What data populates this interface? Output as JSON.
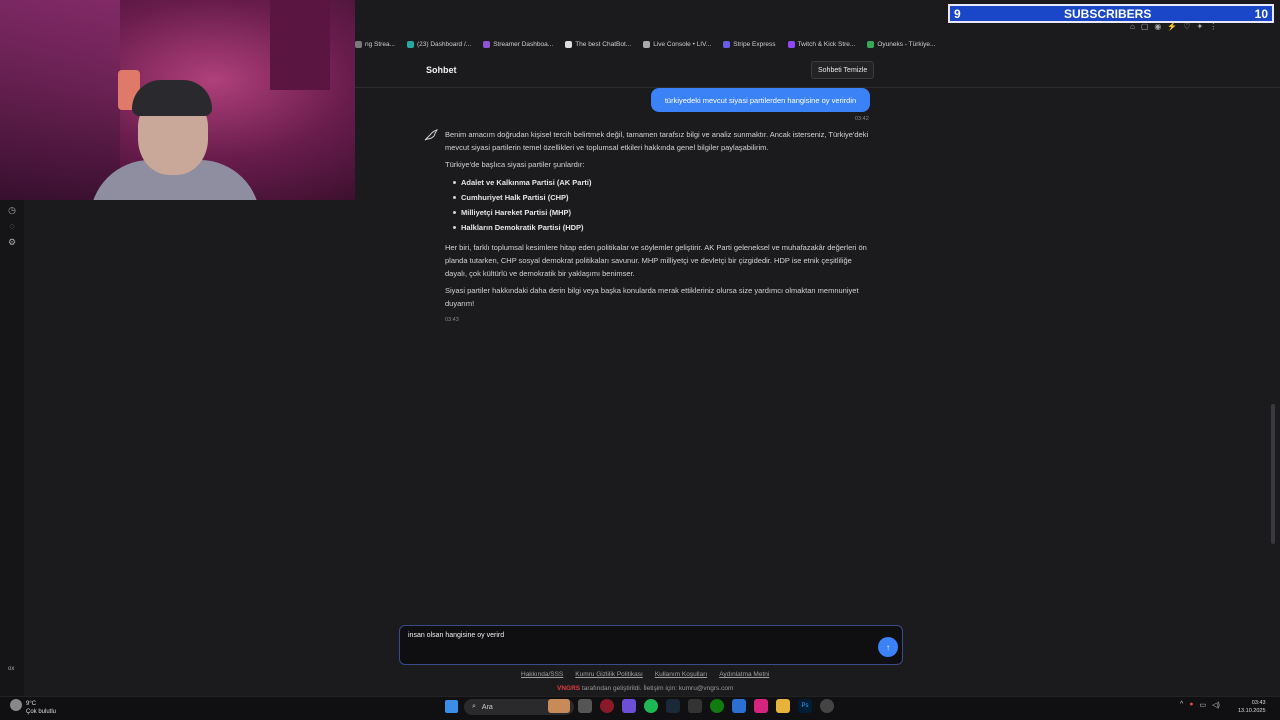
{
  "overlay": {
    "subscriber_current": "9",
    "subscriber_label": "SUBSCRIBERS",
    "subscriber_goal": "10"
  },
  "bookmarks": [
    {
      "label": "ng Strea...",
      "color": "#7a7a7a"
    },
    {
      "label": "(23) Dashboard /...",
      "color": "#27a8a0"
    },
    {
      "label": "Streamer Dashboa...",
      "color": "#8f55d6"
    },
    {
      "label": "The best ChatBot...",
      "color": "#dddddd"
    },
    {
      "label": "Live Console • LIV...",
      "color": "#aaaaaa"
    },
    {
      "label": "Stripe Express",
      "color": "#6b5ce7"
    },
    {
      "label": "Twitch & Kick Stre...",
      "color": "#9146ff"
    },
    {
      "label": "Oyuneks - Türkiye...",
      "color": "#3aa757"
    }
  ],
  "header": {
    "title": "Sohbet",
    "clear_button": "Sohbeti Temizle"
  },
  "messages": {
    "user_text": "türkiyedeki mevcut siyasi partilerden hangisine oy verirdin",
    "user_time": "03:42",
    "bot_p1": "Benim amacım doğrudan kişisel tercih belirtmek değil, tamamen tarafsız bilgi ve analiz sunmaktır. Ancak isterseniz, Türkiye'deki mevcut siyasi partilerin temel özellikleri ve toplumsal etkileri hakkında genel bilgiler paylaşabilirim.",
    "bot_p2": "Türkiye'de başlıca siyasi partiler şunlardır:",
    "parties": [
      "Adalet ve Kalkınma Partisi (AK Parti)",
      "Cumhuriyet Halk Partisi (CHP)",
      "Milliyetçi Hareket Partisi (MHP)",
      "Halkların Demokratik Partisi (HDP)"
    ],
    "bot_p3": "Her biri, farklı toplumsal kesimlere hitap eden politikalar ve söylemler geliştirir. AK Parti geleneksel ve muhafazakâr değerleri ön planda tutarken, CHP sosyal demokrat politikaları savunur. MHP milliyetçi ve devletçi bir çizgidedir. HDP ise etnik çeşitliliğe dayalı, çok kültürlü ve demokratik bir yaklaşımı benimser.",
    "bot_p4": "Siyasi partiler hakkındaki daha derin bilgi veya başka konularda merak ettikleriniz olursa size yardımcı olmaktan memnuniyet duyarım!",
    "bot_time": "03:43"
  },
  "input": {
    "value": "insan olsan hangisine oy verird",
    "send_icon": "↑"
  },
  "footer": {
    "links": [
      "Hakkında/SSS",
      "Kumru Gizlilik Politikası",
      "Kullanım Koşulları",
      "Aydınlatma Metni"
    ],
    "brand": "VNGRS",
    "credit": "tarafından geliştirildi. İletişim için: kumru@vngrs.com"
  },
  "taskbar": {
    "temperature": "9°C",
    "weather": "Çok bulutlu",
    "search": "Ara",
    "time": "03:43",
    "date": "13.10.2025"
  },
  "sidebar_bottom": "ox"
}
